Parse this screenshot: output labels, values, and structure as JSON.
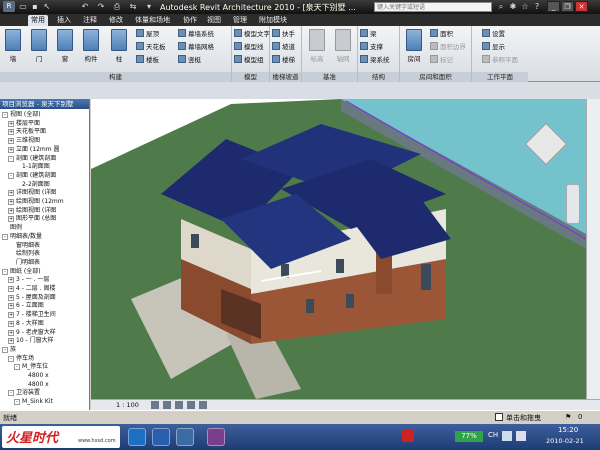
{
  "titlebar": {
    "app_title": "Autodesk Revit Architecture 2010 - [泉天下别墅 ...",
    "search_placeholder": "键入关键字或短语"
  },
  "ribbon_tabs": [
    "常用",
    "插入",
    "注释",
    "修改",
    "体量和场地",
    "协作",
    "视图",
    "管理",
    "附加模块"
  ],
  "ribbon": {
    "build": {
      "title": "构建",
      "big": [
        "墙",
        "门",
        "窗",
        "构件",
        "柱"
      ],
      "small": [
        "屋顶",
        "天花板",
        "楼板",
        "幕墙系统",
        "幕墙网格",
        "竖梃"
      ]
    },
    "model": {
      "title": "模型",
      "small": [
        "模型文字",
        "模型线",
        "模型组"
      ]
    },
    "circulation": {
      "title": "楼梯坡道",
      "small": [
        "扶手",
        "坡道",
        "楼梯"
      ]
    },
    "datum": {
      "title": "基准",
      "small": [
        "标高",
        "轴网"
      ]
    },
    "structure": {
      "title": "结构",
      "small": [
        "梁",
        "支撑",
        "梁系统"
      ]
    },
    "room": {
      "title": "房间和面积",
      "big": "房间",
      "small": [
        "面积",
        "面积边界",
        "标记"
      ]
    },
    "workplane": {
      "title": "工作平面",
      "small": [
        "设置",
        "显示",
        "参照平面"
      ]
    }
  },
  "browser": {
    "title": "项目浏览器 - 泉天下别墅",
    "items": [
      {
        "label": "视图 (全部)",
        "exp": "-"
      },
      {
        "label": "楼层平面",
        "exp": "+"
      },
      {
        "label": "天花板平面",
        "exp": "+"
      },
      {
        "label": "三维视图",
        "exp": "+"
      },
      {
        "label": "立面 (12mm 圆",
        "exp": "+"
      },
      {
        "label": "剖面 (建筑剖面",
        "exp": "-"
      },
      {
        "label": "1-1剖面图",
        "exp": ""
      },
      {
        "label": "剖面 (建筑剖面",
        "exp": "-"
      },
      {
        "label": "2-2剖面图",
        "exp": ""
      },
      {
        "label": "详图视图 (详图",
        "exp": "+"
      },
      {
        "label": "绘图视图 (12mm",
        "exp": "+"
      },
      {
        "label": "绘图视图 (详图",
        "exp": "+"
      },
      {
        "label": "图形平面 (总图",
        "exp": "+"
      },
      {
        "label": "图例",
        "exp": ""
      },
      {
        "label": "明细表/数量",
        "exp": "-"
      },
      {
        "label": "窗明细表",
        "exp": ""
      },
      {
        "label": "绘制列表",
        "exp": ""
      },
      {
        "label": "门明细表",
        "exp": ""
      },
      {
        "label": "图纸 (全部)",
        "exp": "-"
      },
      {
        "label": "3 - 一 . 一层",
        "exp": "+"
      },
      {
        "label": "4 - 二层 . 阁楼",
        "exp": "+"
      },
      {
        "label": "5 - 屋面及剖面",
        "exp": "+"
      },
      {
        "label": "6 - 立面图",
        "exp": "+"
      },
      {
        "label": "7 - 楼梯卫生间",
        "exp": "+"
      },
      {
        "label": "8 - 大样图",
        "exp": "+"
      },
      {
        "label": "9 - 老虎窗大样",
        "exp": "+"
      },
      {
        "label": "10 - 门窗大样",
        "exp": "+"
      },
      {
        "label": "族",
        "exp": "-"
      },
      {
        "label": "停车场",
        "exp": "-"
      },
      {
        "label": "M_停车位",
        "exp": "-"
      },
      {
        "label": "4800 x",
        "exp": ""
      },
      {
        "label": "4800 x",
        "exp": ""
      },
      {
        "label": "卫浴装置",
        "exp": "-"
      },
      {
        "label": "M_Sink Kit",
        "exp": "-"
      }
    ]
  },
  "viewctrl": {
    "scale": "1 : 100"
  },
  "status": {
    "left": "就绪",
    "press_drag": "单击和拖曳",
    "filter_count": "0"
  },
  "taskbar": {
    "logo_text": "火星时代",
    "logo_url": "www.hxsd.com",
    "battery": "77%",
    "lang": "CH",
    "time": "15:20",
    "date": "2010-02-21"
  },
  "colors": {
    "roof": "#1d2a6e",
    "brick": "#8a4a2e",
    "grass": "#4f7b4a",
    "water": "#74c2cc",
    "wall": "#e9e6dc"
  }
}
